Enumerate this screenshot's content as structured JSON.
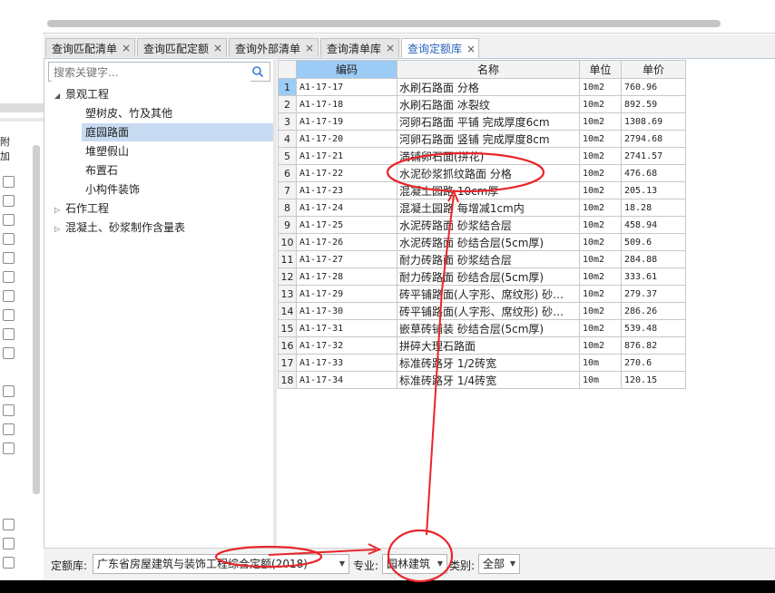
{
  "left_panel": {
    "header": "附加"
  },
  "tabs": [
    {
      "label": "查询匹配清单",
      "active": false
    },
    {
      "label": "查询匹配定额",
      "active": false
    },
    {
      "label": "查询外部清单",
      "active": false
    },
    {
      "label": "查询清单库",
      "active": false
    },
    {
      "label": "查询定额库",
      "active": true
    }
  ],
  "tab_close_glyph": "×",
  "search": {
    "placeholder": "搜索关键字...",
    "icon": "search-icon"
  },
  "tree": [
    {
      "label": "景观工程",
      "level": 0,
      "expanded": true
    },
    {
      "label": "塑树皮、竹及其他",
      "level": 1
    },
    {
      "label": "庭园路面",
      "level": 1,
      "selected": true
    },
    {
      "label": "堆塑假山",
      "level": 1
    },
    {
      "label": "布置石",
      "level": 1
    },
    {
      "label": "小构件装饰",
      "level": 1
    },
    {
      "label": "石作工程",
      "level": 0,
      "expanded": false
    },
    {
      "label": "混凝土、砂浆制作含量表",
      "level": 0,
      "expanded": false
    }
  ],
  "grid": {
    "columns": [
      "编码",
      "名称",
      "单位",
      "单价"
    ],
    "rows": [
      {
        "idx": "1",
        "code": "A1-17-17",
        "name": "水刷石路面 分格",
        "unit": "10m2",
        "price": "760.96"
      },
      {
        "idx": "2",
        "code": "A1-17-18",
        "name": "水刷石路面 冰裂纹",
        "unit": "10m2",
        "price": "892.59"
      },
      {
        "idx": "3",
        "code": "A1-17-19",
        "name": "河卵石路面 平铺 完成厚度6cm",
        "unit": "10m2",
        "price": "1308.69"
      },
      {
        "idx": "4",
        "code": "A1-17-20",
        "name": "河卵石路面 竖铺 完成厚度8cm",
        "unit": "10m2",
        "price": "2794.68"
      },
      {
        "idx": "5",
        "code": "A1-17-21",
        "name": "満铺卵石面(拼花)",
        "unit": "10m2",
        "price": "2741.57"
      },
      {
        "idx": "6",
        "code": "A1-17-22",
        "name": "水泥砂浆抓纹路面 分格",
        "unit": "10m2",
        "price": "476.68"
      },
      {
        "idx": "7",
        "code": "A1-17-23",
        "name": "混凝土园路 10cm厚",
        "unit": "10m2",
        "price": "205.13"
      },
      {
        "idx": "8",
        "code": "A1-17-24",
        "name": "混凝土园路 每增减1cm内",
        "unit": "10m2",
        "price": "18.28"
      },
      {
        "idx": "9",
        "code": "A1-17-25",
        "name": "水泥砖路面 砂浆结合层",
        "unit": "10m2",
        "price": "458.94"
      },
      {
        "idx": "10",
        "code": "A1-17-26",
        "name": "水泥砖路面 砂结合层(5cm厚)",
        "unit": "10m2",
        "price": "509.6"
      },
      {
        "idx": "11",
        "code": "A1-17-27",
        "name": "耐力砖路面 砂浆结合层",
        "unit": "10m2",
        "price": "284.88"
      },
      {
        "idx": "12",
        "code": "A1-17-28",
        "name": "耐力砖路面 砂结合层(5cm厚)",
        "unit": "10m2",
        "price": "333.61"
      },
      {
        "idx": "13",
        "code": "A1-17-29",
        "name": "砖平铺路面(人字形、席纹形) 砂…",
        "unit": "10m2",
        "price": "279.37"
      },
      {
        "idx": "14",
        "code": "A1-17-30",
        "name": "砖平铺路面(人字形、席纹形) 砂…",
        "unit": "10m2",
        "price": "286.26"
      },
      {
        "idx": "15",
        "code": "A1-17-31",
        "name": "嵌草砖铺装 砂结合层(5cm厚)",
        "unit": "10m2",
        "price": "539.48"
      },
      {
        "idx": "16",
        "code": "A1-17-32",
        "name": "拼碎大理石路面",
        "unit": "10m2",
        "price": "876.82"
      },
      {
        "idx": "17",
        "code": "A1-17-33",
        "name": "标准砖路牙 1/2砖宽",
        "unit": "10m",
        "price": "270.6"
      },
      {
        "idx": "18",
        "code": "A1-17-34",
        "name": "标准砖路牙 1/4砖宽",
        "unit": "10m",
        "price": "120.15"
      }
    ]
  },
  "bottom": {
    "quota_label": "定额库:",
    "quota_value": "广东省房屋建筑与装饰工程综合定额(2018)",
    "major_label": "专业:",
    "major_value": "园林建筑",
    "category_label": "类别:",
    "category_value": "全部"
  },
  "colors": {
    "accent": "#2a62b8",
    "header_highlight": "#9ccbf6",
    "annotation": "#e8262b",
    "selection": "#c7dbf2"
  }
}
